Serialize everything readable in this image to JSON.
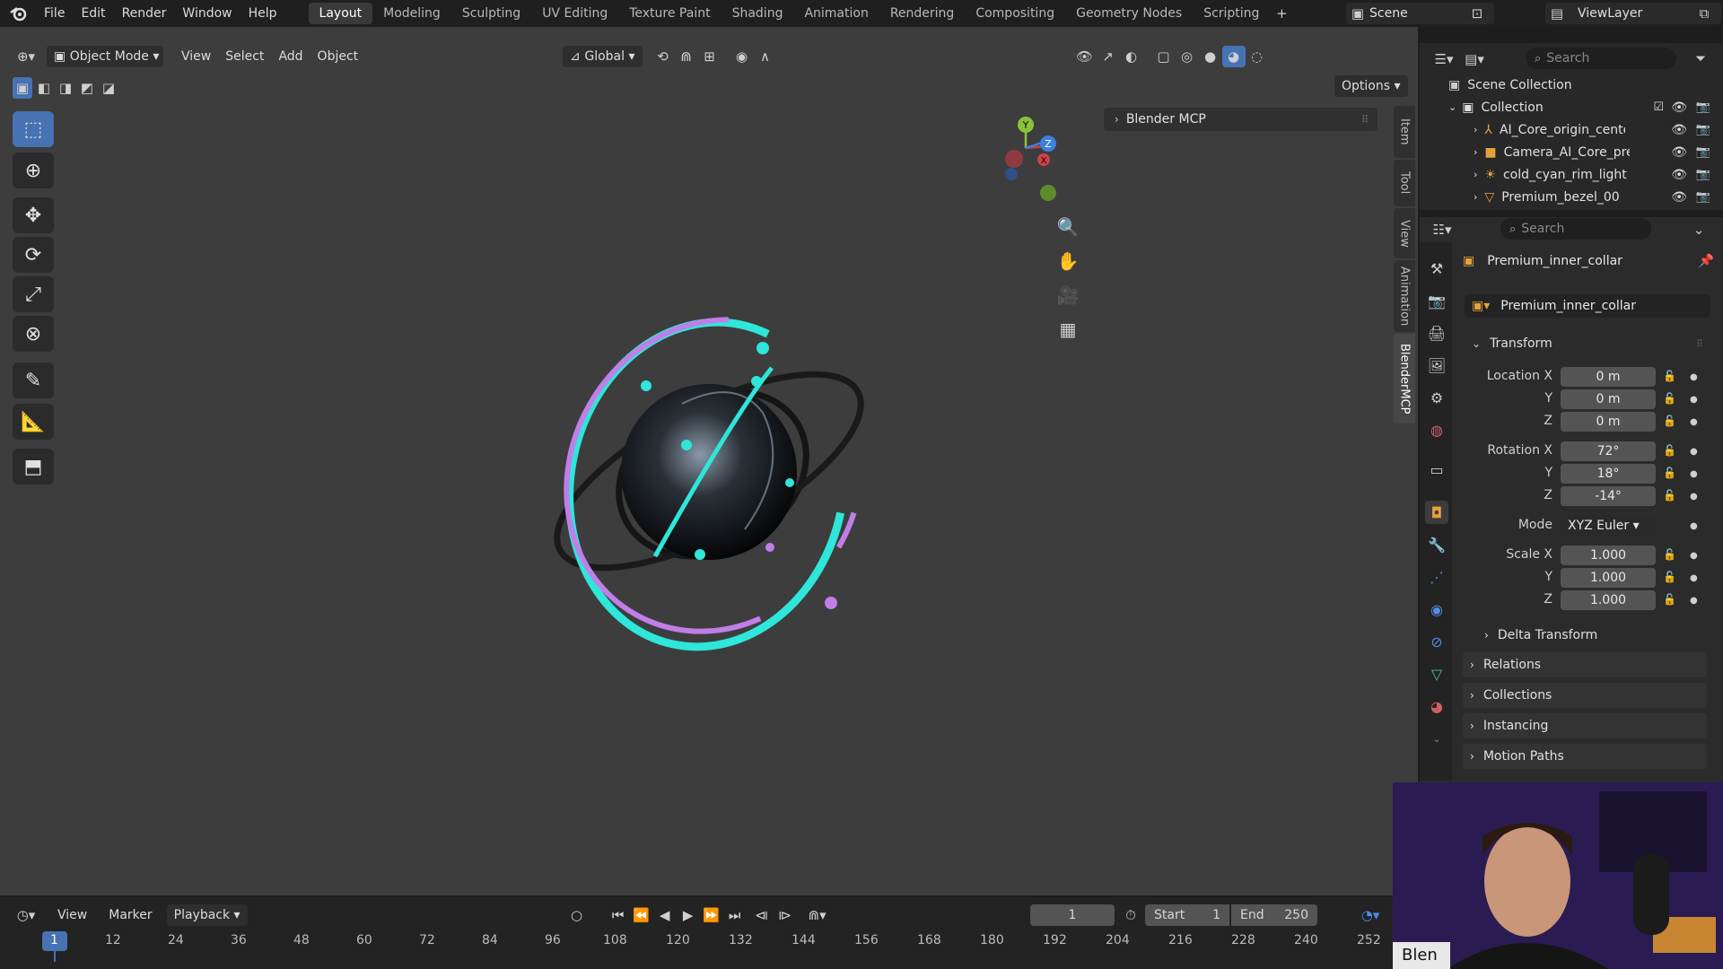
{
  "window_title": "BlenderMCP",
  "menu": [
    "File",
    "Edit",
    "Render",
    "Window",
    "Help"
  ],
  "workspaces": [
    "Layout",
    "Modeling",
    "Sculpting",
    "UV Editing",
    "Texture Paint",
    "Shading",
    "Animation",
    "Rendering",
    "Compositing",
    "Geometry Nodes",
    "Scripting"
  ],
  "active_workspace": "Layout",
  "scene": "Scene",
  "view_layer": "ViewLayer",
  "viewport_header": {
    "mode": "Object Mode",
    "menus": [
      "View",
      "Select",
      "Add",
      "Object"
    ],
    "transform": "Global",
    "options": "Options"
  },
  "n_panel": {
    "header": "Blender MCP",
    "tabs": [
      "Item",
      "Tool",
      "View",
      "Animation",
      "BlenderMCP"
    ],
    "active_tab": "BlenderMCP"
  },
  "gizmo": {
    "y": "Y",
    "z": "Z",
    "x": "X"
  },
  "outliner": {
    "search_placeholder": "Search",
    "scene_collection": "Scene Collection",
    "collection": "Collection",
    "items": [
      "AI_Core_origin_center",
      "Camera_AI_Core_pre",
      "cold_cyan_rim_light",
      "Premium_bezel_00"
    ]
  },
  "properties": {
    "search_placeholder": "Search",
    "object_name": "Premium_inner_collar",
    "object_field": "Premium_inner_collar",
    "transform_label": "Transform",
    "location": {
      "label": "Location",
      "x": "0 m",
      "y": "0 m",
      "z": "0 m"
    },
    "rotation": {
      "label": "Rotation",
      "x": "72°",
      "y": "18°",
      "z": "-14°"
    },
    "mode_label": "Mode",
    "mode": "XYZ Euler",
    "scale": {
      "label": "Scale",
      "x": "1.000",
      "y": "1.000",
      "z": "1.000"
    },
    "axis": {
      "x": "X",
      "y": "Y",
      "z": "Z"
    },
    "sections": [
      "Delta Transform",
      "Relations",
      "Collections",
      "Instancing",
      "Motion Paths"
    ]
  },
  "timeline": {
    "menus": [
      "View",
      "Marker",
      "Playback"
    ],
    "current_frame": "1",
    "start_label": "Start",
    "start": "1",
    "end_label": "End",
    "end": "250",
    "ticks": [
      "1",
      "12",
      "24",
      "36",
      "48",
      "60",
      "72",
      "84",
      "96",
      "108",
      "120",
      "132",
      "144",
      "156",
      "168",
      "180",
      "192",
      "204",
      "216",
      "228",
      "240",
      "252"
    ]
  },
  "webcam_caption": "Blen",
  "colors": {
    "accent": "#4772b3",
    "cyan": "#2ee6d9",
    "purple": "#c07ee8"
  }
}
